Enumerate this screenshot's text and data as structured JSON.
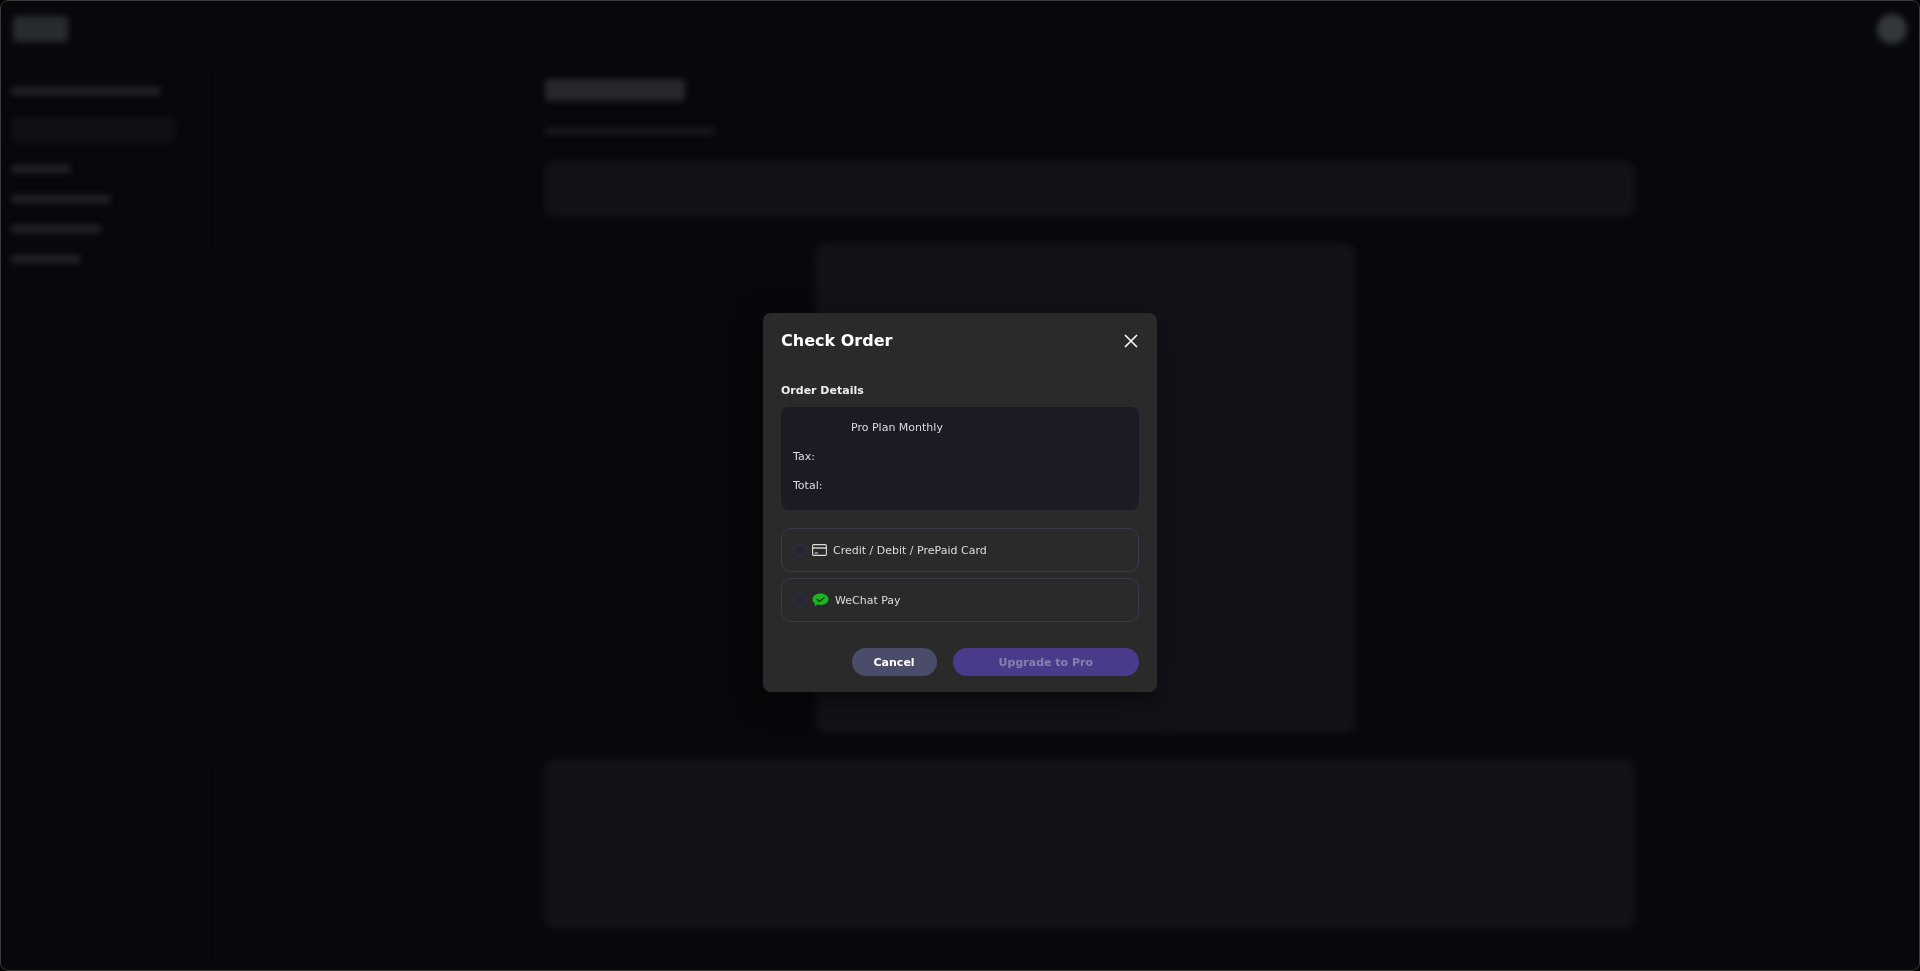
{
  "dialog": {
    "title": "Check Order",
    "section_label": "Order Details",
    "summary": {
      "plan": "Pro Plan Monthly",
      "tax_label": "Tax:",
      "total_label": "Total:"
    },
    "payment_methods": [
      {
        "kind": "card",
        "label": "Credit / Debit / PrePaid Card",
        "selected": false
      },
      {
        "kind": "wechat",
        "label": "WeChat Pay",
        "selected": false
      }
    ],
    "buttons": [
      {
        "kind": "secondary",
        "label": "Cancel",
        "disabled": false
      },
      {
        "kind": "primary",
        "label": "Upgrade to Pro",
        "disabled": true
      }
    ]
  }
}
